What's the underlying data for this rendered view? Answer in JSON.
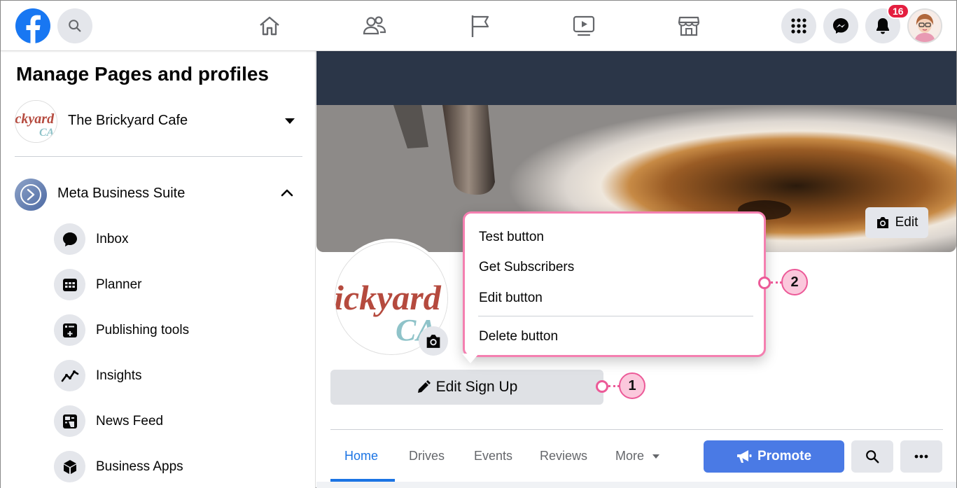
{
  "topbar": {
    "notification_count": "16"
  },
  "sidebar": {
    "title": "Manage Pages and profiles",
    "page_name": "The Brickyard Cafe",
    "suite_label": "Meta Business Suite",
    "items": [
      {
        "label": "Inbox",
        "icon": "chat-bubble-icon"
      },
      {
        "label": "Planner",
        "icon": "calendar-grid-icon"
      },
      {
        "label": "Publishing tools",
        "icon": "publishing-tools-icon"
      },
      {
        "label": "Insights",
        "icon": "insights-chart-icon"
      },
      {
        "label": "News Feed",
        "icon": "news-feed-icon"
      },
      {
        "label": "Business Apps",
        "icon": "cube-icon"
      }
    ]
  },
  "main": {
    "cover_edit_label": "Edit",
    "edit_signup_label": "Edit Sign Up",
    "logo_text_1": "ickyard",
    "logo_text_2": "CA",
    "tabs": [
      {
        "label": "Home"
      },
      {
        "label": "Drives"
      },
      {
        "label": "Events"
      },
      {
        "label": "Reviews"
      },
      {
        "label": "More"
      }
    ],
    "promote_label": "Promote"
  },
  "popup": {
    "items": [
      {
        "label": "Test button"
      },
      {
        "label": "Get Subscribers"
      },
      {
        "label": "Edit button"
      },
      {
        "label": "Delete button"
      }
    ]
  },
  "callouts": {
    "one": "1",
    "two": "2"
  },
  "colors": {
    "brand_blue": "#1877f2",
    "link_blue": "#1b74e4",
    "promote_blue": "#4a7ae5",
    "callout_pink": "#ec5a98",
    "badge_red": "#e41e3f"
  }
}
